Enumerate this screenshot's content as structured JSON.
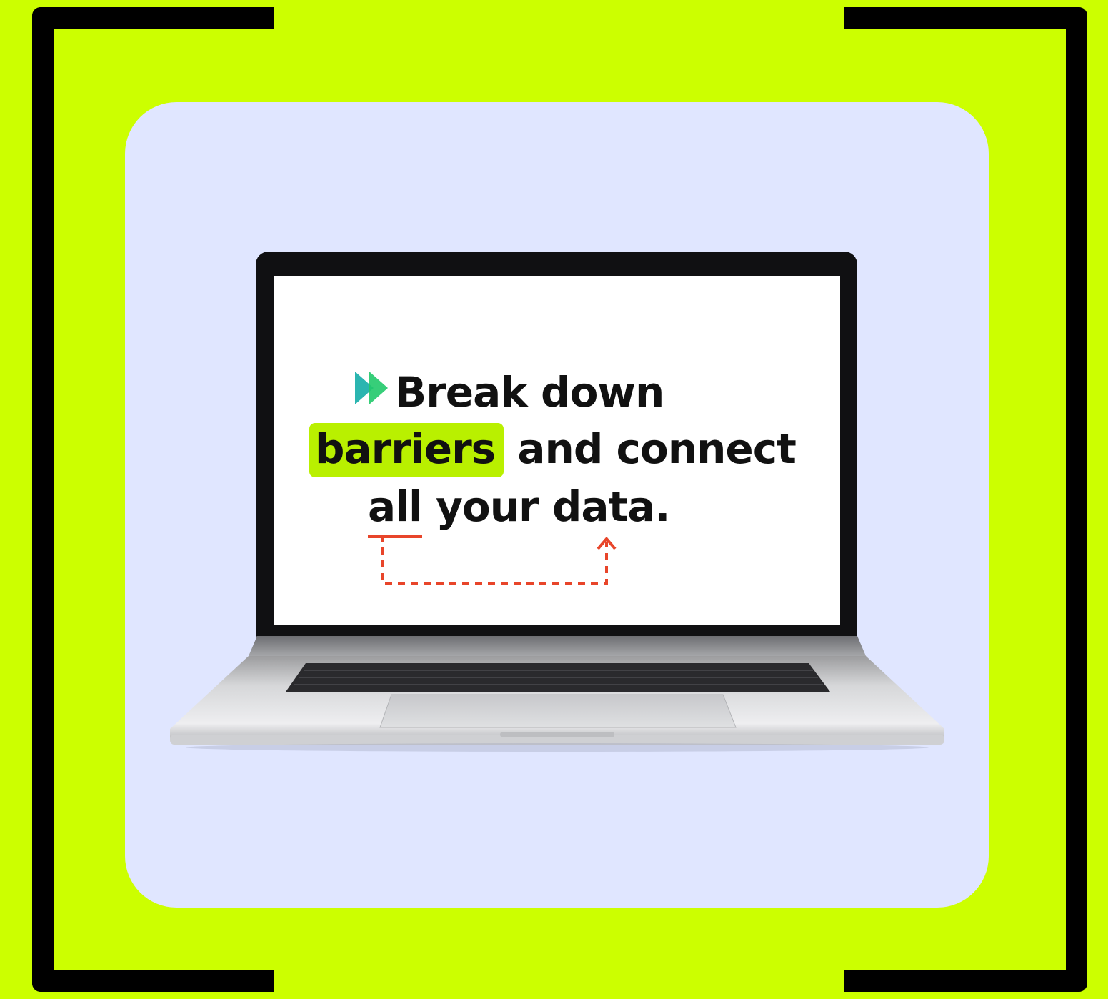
{
  "screen": {
    "line1": "Break down",
    "line2_highlight": "barriers",
    "line2_rest": " and connect",
    "line3_underlined": "all",
    "line3_rest": " your data."
  },
  "icons": {
    "play": "double-play-icon",
    "arrow": "dashed-return-arrow-icon"
  },
  "colors": {
    "background": "#ccff00",
    "card": "#e0e6ff",
    "highlight": "#b9f000",
    "accent_red": "#e8452a",
    "icon_teal": "#2bb5b0",
    "icon_green": "#21c96a",
    "frame": "#000000"
  }
}
